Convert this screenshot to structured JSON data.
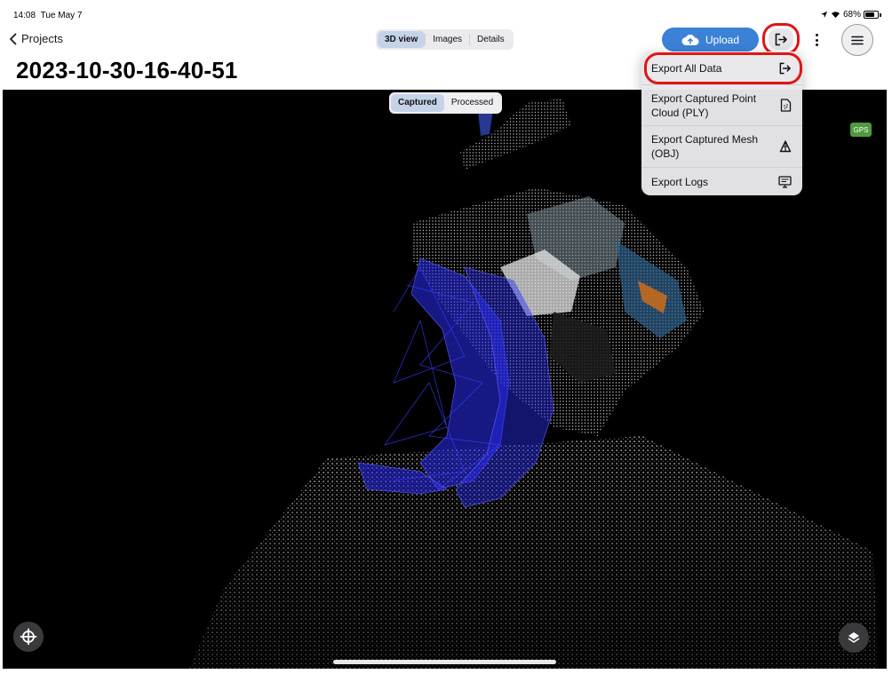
{
  "status_bar": {
    "time": "14:08",
    "date": "Tue May 7",
    "battery": "68%"
  },
  "nav": {
    "back_label": "Projects",
    "title": "2023-10-30-16-40-51"
  },
  "top_tabs": [
    {
      "label": "3D view",
      "active": true
    },
    {
      "label": "Images",
      "active": false
    },
    {
      "label": "Details",
      "active": false
    }
  ],
  "toolbar": {
    "upload_label": "Upload"
  },
  "view_toggle": [
    {
      "label": "Captured",
      "active": true
    },
    {
      "label": "Processed",
      "active": false
    }
  ],
  "gps_badge": "GPS",
  "export_menu": {
    "items": [
      {
        "label": "Export All Data",
        "icon": "export-icon"
      },
      {
        "label": "Export Captured Point Cloud (PLY)",
        "icon": "file-icon"
      },
      {
        "label": "Export Captured Mesh (OBJ)",
        "icon": "mesh-icon"
      },
      {
        "label": "Export Logs",
        "icon": "logs-icon"
      }
    ]
  },
  "colors": {
    "accent": "#3b82d6",
    "highlight": "#e01515",
    "gps": "#4f9a3d",
    "segment_active": "#c5d3e8"
  }
}
